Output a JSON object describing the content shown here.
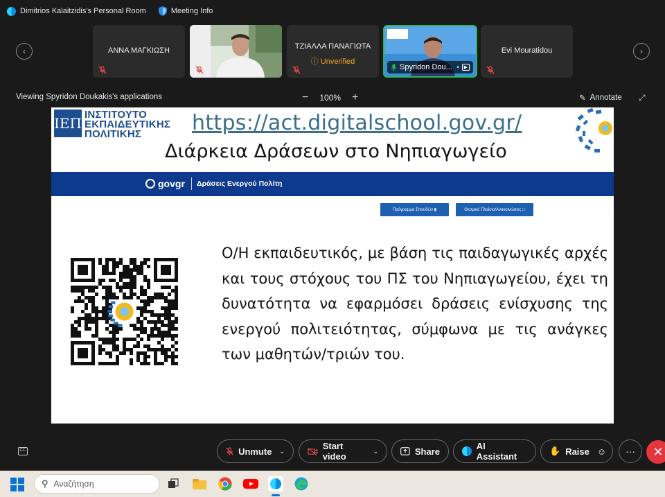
{
  "topbar": {
    "room_title": "Dimitrios Kalaitzidis's Personal Room",
    "meeting_info": "Meeting Info"
  },
  "participants": [
    {
      "name": "ΑΝΝΑ ΜΑΓΚΙΩΣΗ",
      "muted": true,
      "video": false
    },
    {
      "name": "",
      "muted": true,
      "video": true
    },
    {
      "name": "ΤΖΙΑΛΛΑ ΠΑΝΑΓΙΩΤΑ",
      "status": "Unverified",
      "muted": true,
      "video": false
    },
    {
      "name": "Spyridon Dou...",
      "muted": false,
      "video": true,
      "active": true
    },
    {
      "name": "Evi Mouratidou",
      "muted": true,
      "video": false
    }
  ],
  "share_header": {
    "viewing": "Viewing Spyridon Doukakis's applications",
    "zoom": "100%",
    "annotate": "Annotate"
  },
  "slide": {
    "logo_mark": "ΙΕΠ",
    "logo_lines": [
      "ΙΝΣΤΙΤΟΥΤΟ",
      "ΕΚΠΑΙΔΕΥΤΙΚΗΣ",
      "ΠΟΛΙΤΙΚΗΣ"
    ],
    "url": "https://act.digitalschool.gov.gr/",
    "title": "Διάρκεια Δράσεων στο Νηπιαγωγείο",
    "gov_logo": "govgr",
    "gov_title": "Δράσεις Ενεργού Πολίτη",
    "btn1": "Πρόγραμμα Σπουδών",
    "btn2": "Θεσμικό Πλαίσιο/Ανακοινώσεις",
    "body": "Ο/Η εκπαιδευτικός, με βάση τις παιδαγωγικές αρχές και τους στόχους του ΠΣ του Νηπιαγωγείου, έχει τη δυνατότητα να εφαρμόσει δράσεις ενίσχυσης της ενεργού πολιτειότητας, σύμφωνα με τις ανάγκες των μαθητών/τριών του."
  },
  "controls": {
    "unmute": "Unmute",
    "start_video": "Start video",
    "share": "Share",
    "ai_assistant": "AI Assistant",
    "raise": "Raise",
    "more": "···"
  },
  "taskbar": {
    "search_placeholder": "Αναζήτηση"
  },
  "colors": {
    "accent_green": "#2fb35c",
    "unverified": "#f5a623",
    "leave_red": "#e5353d",
    "gov_blue": "#0d3a8c",
    "iep_blue": "#1d4e8f"
  }
}
